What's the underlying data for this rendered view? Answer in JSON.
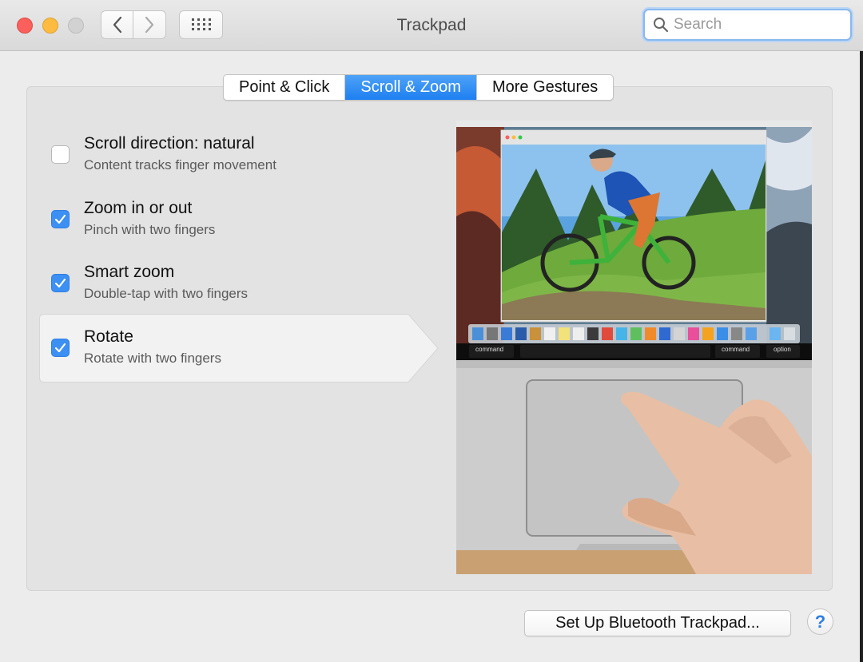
{
  "window": {
    "title": "Trackpad"
  },
  "search": {
    "placeholder": "Search",
    "value": ""
  },
  "tabs": [
    {
      "label": "Point & Click",
      "active": false
    },
    {
      "label": "Scroll & Zoom",
      "active": true
    },
    {
      "label": "More Gestures",
      "active": false
    }
  ],
  "options": [
    {
      "title": "Scroll direction: natural",
      "subtitle": "Content tracks finger movement",
      "checked": false
    },
    {
      "title": "Zoom in or out",
      "subtitle": "Pinch with two fingers",
      "checked": true
    },
    {
      "title": "Smart zoom",
      "subtitle": "Double-tap with two fingers",
      "checked": true
    },
    {
      "title": "Rotate",
      "subtitle": "Rotate with two fingers",
      "checked": true,
      "selected": true
    }
  ],
  "preview": {
    "keys": {
      "command_left": "command",
      "command_right": "command",
      "option": "option"
    }
  },
  "footer": {
    "bluetooth_label": "Set Up Bluetooth Trackpad...",
    "help_label": "?"
  },
  "colors": {
    "accent": "#3c8ff3",
    "close": "#fc605c",
    "minimize": "#fdbc40",
    "zoom_disabled": "#d2d2d2"
  },
  "icons": [
    "chevron-left-icon",
    "chevron-right-icon",
    "grid-icon",
    "search-icon",
    "checkmark-icon",
    "help-icon"
  ]
}
